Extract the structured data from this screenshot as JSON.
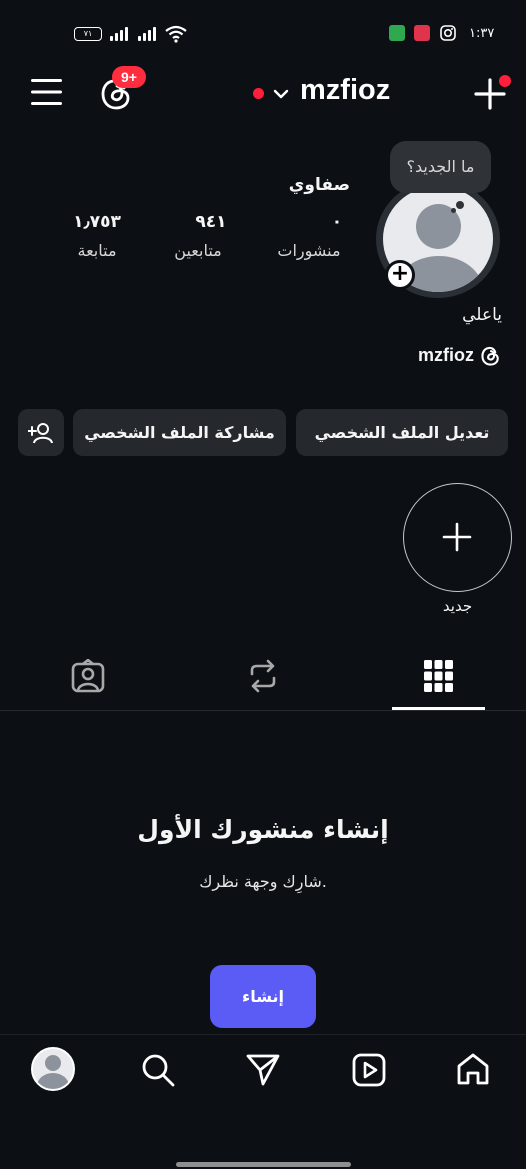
{
  "status_bar": {
    "time": "١:٣٧",
    "battery": "٧١"
  },
  "header": {
    "username": "mzfioz",
    "notifications_badge": "9+",
    "icons": [
      "menu-icon",
      "threads-icon",
      "chevron-down-icon",
      "plus-icon"
    ]
  },
  "profile": {
    "display_name": "صفاوي",
    "bubble_text": "ما الجديد؟",
    "bio": "ياعلي",
    "handle": "mzfioz",
    "stats": [
      {
        "value": "٠",
        "label": "منشورات"
      },
      {
        "value": "٩٤١",
        "label": "متابعين"
      },
      {
        "value": "١٫٧٥٣",
        "label": "متابعة"
      }
    ]
  },
  "actions": {
    "edit_profile": "تعديل الملف الشخصي",
    "share_profile": "مشاركة الملف الشخصي"
  },
  "highlights": {
    "new_label": "جديد"
  },
  "tabs": [
    "grid-icon",
    "reposts-icon",
    "tagged-icon"
  ],
  "empty_state": {
    "title": "إنشاء منشورك الأول",
    "subtitle": "شارِك وجهة نظرك.",
    "create_button": "إنشاء"
  },
  "bottom_nav": [
    "home-icon",
    "reels-icon",
    "send-icon",
    "search-icon",
    "profile-avatar"
  ],
  "colors": {
    "background": "#0c1014",
    "button": "#25292e",
    "accent": "#5a5cf5",
    "badge": "#ff2d3d"
  }
}
